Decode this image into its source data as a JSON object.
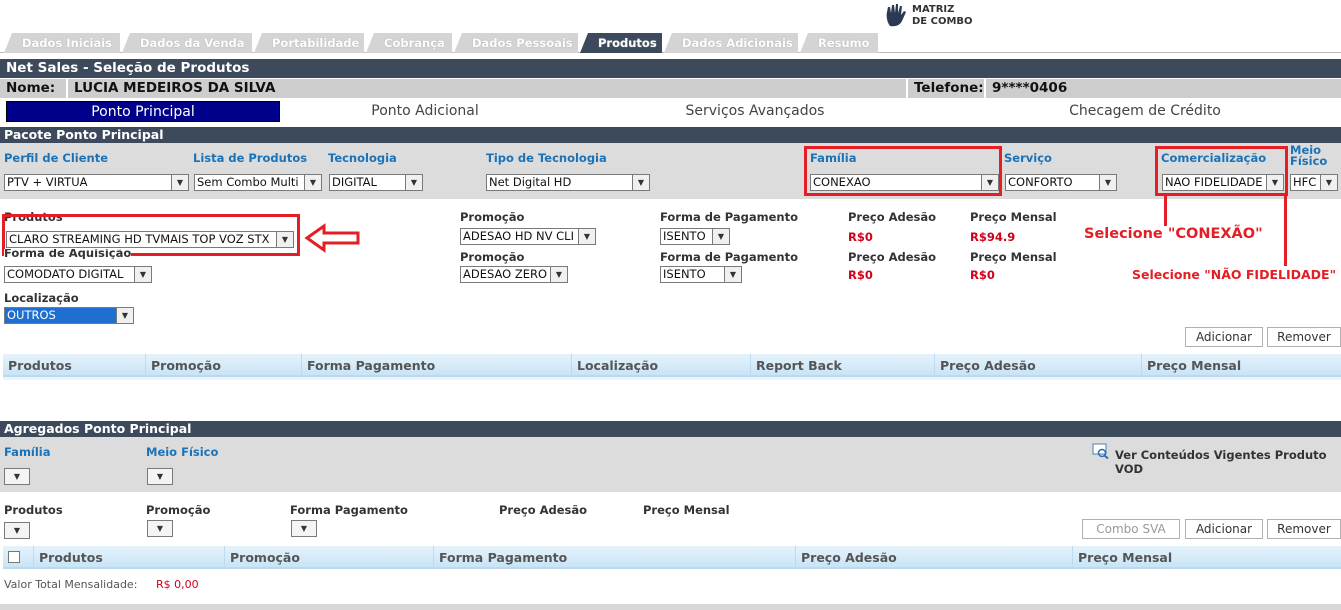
{
  "logo": {
    "line1": "MATRIZ",
    "line2": "DE COMBO"
  },
  "tabs": [
    "Dados Iniciais",
    "Dados da Venda",
    "Portabilidade",
    "Cobrança",
    "Dados Pessoais",
    "Produtos",
    "Dados Adicionais",
    "Resumo"
  ],
  "page_title": "Net Sales - Seleção de Produtos",
  "customer": {
    "name_label": "Nome:",
    "name_value": "LUCIA MEDEIROS DA SILVA",
    "phone_label": "Telefone:",
    "phone_value": "9****0406"
  },
  "subtabs": [
    "Ponto Principal",
    "Ponto Adicional",
    "Serviços Avançados",
    "Checagem de Crédito"
  ],
  "section1_title": "Pacote Ponto Principal",
  "filters": {
    "perfil_label": "Perfil de Cliente",
    "perfil_value": "PTV + VIRTUA",
    "lista_label": "Lista de Produtos",
    "lista_value": "Sem Combo Multi",
    "tecnologia_label": "Tecnologia",
    "tecnologia_value": "DIGITAL",
    "tipo_label": "Tipo de Tecnologia",
    "tipo_value": "Net Digital HD",
    "familia_label": "Família",
    "familia_value": "CONEXAO",
    "servico_label": "Serviço",
    "servico_value": "CONFORTO",
    "comercializacao_label": "Comercialização",
    "comercializacao_value": "NAO FIDELIDADE",
    "meio_label_1": "Meio",
    "meio_label_2": "Físico",
    "meio_value": "HFC"
  },
  "product": {
    "produtos_label": "Produtos",
    "produtos_value": "CLARO STREAMING HD TVMAIS TOP VOZ STX",
    "aquisicao_label": "Forma de Aquisição",
    "aquisicao_value": "COMODATO DIGITAL",
    "localizacao_label": "Localização",
    "localizacao_value": "OUTROS",
    "promo1_label": "Promoção",
    "promo1_value": "ADESAO HD NV CLI",
    "pag1_label": "Forma de Pagamento",
    "pag1_value": "ISENTO",
    "adesao1_label": "Preço Adesão",
    "adesao1_value": "R$0",
    "mensal1_label": "Preço Mensal",
    "mensal1_value": "R$94.9",
    "promo2_label": "Promoção",
    "promo2_value": "ADESAO ZERO",
    "pag2_label": "Forma de Pagamento",
    "pag2_value": "ISENTO",
    "adesao2_label": "Preço Adesão",
    "adesao2_value": "R$0",
    "mensal2_label": "Preço Mensal",
    "mensal2_value": "R$0"
  },
  "annotations": {
    "conexao": "Selecione \"CONEXÃO\"",
    "nao_fidelidade": "Selecione \"NÃO FIDELIDADE\""
  },
  "buttons": {
    "adicionar": "Adicionar",
    "remover": "Remover",
    "combo_sva": "Combo SVA"
  },
  "table1_headers": [
    "Produtos",
    "Promoção",
    "Forma Pagamento",
    "Localização",
    "Report Back",
    "Preço Adesão",
    "Preço Mensal"
  ],
  "section2_title": "Agregados Ponto Principal",
  "agg": {
    "familia_label": "Família",
    "meio_label": "Meio Físico",
    "vod_link": "Ver Conteúdos Vigentes Produto VOD",
    "produtos_label": "Produtos",
    "promocao_label": "Promoção",
    "pagamento_label": "Forma Pagamento",
    "adesao_label": "Preço Adesão",
    "mensal_label": "Preço Mensal"
  },
  "table2_headers": [
    "Produtos",
    "Promoção",
    "Forma Pagamento",
    "Preço Adesão",
    "Preço Mensal"
  ],
  "total": {
    "label": "Valor Total Mensalidade:",
    "value": "R$ 0,00"
  },
  "colors": {
    "dark_bar": "#3c4a5c",
    "active_subtab": "#00008b",
    "annotation_red": "#e31e24",
    "price_red": "#d0021b",
    "link_blue": "#1a73b8"
  }
}
